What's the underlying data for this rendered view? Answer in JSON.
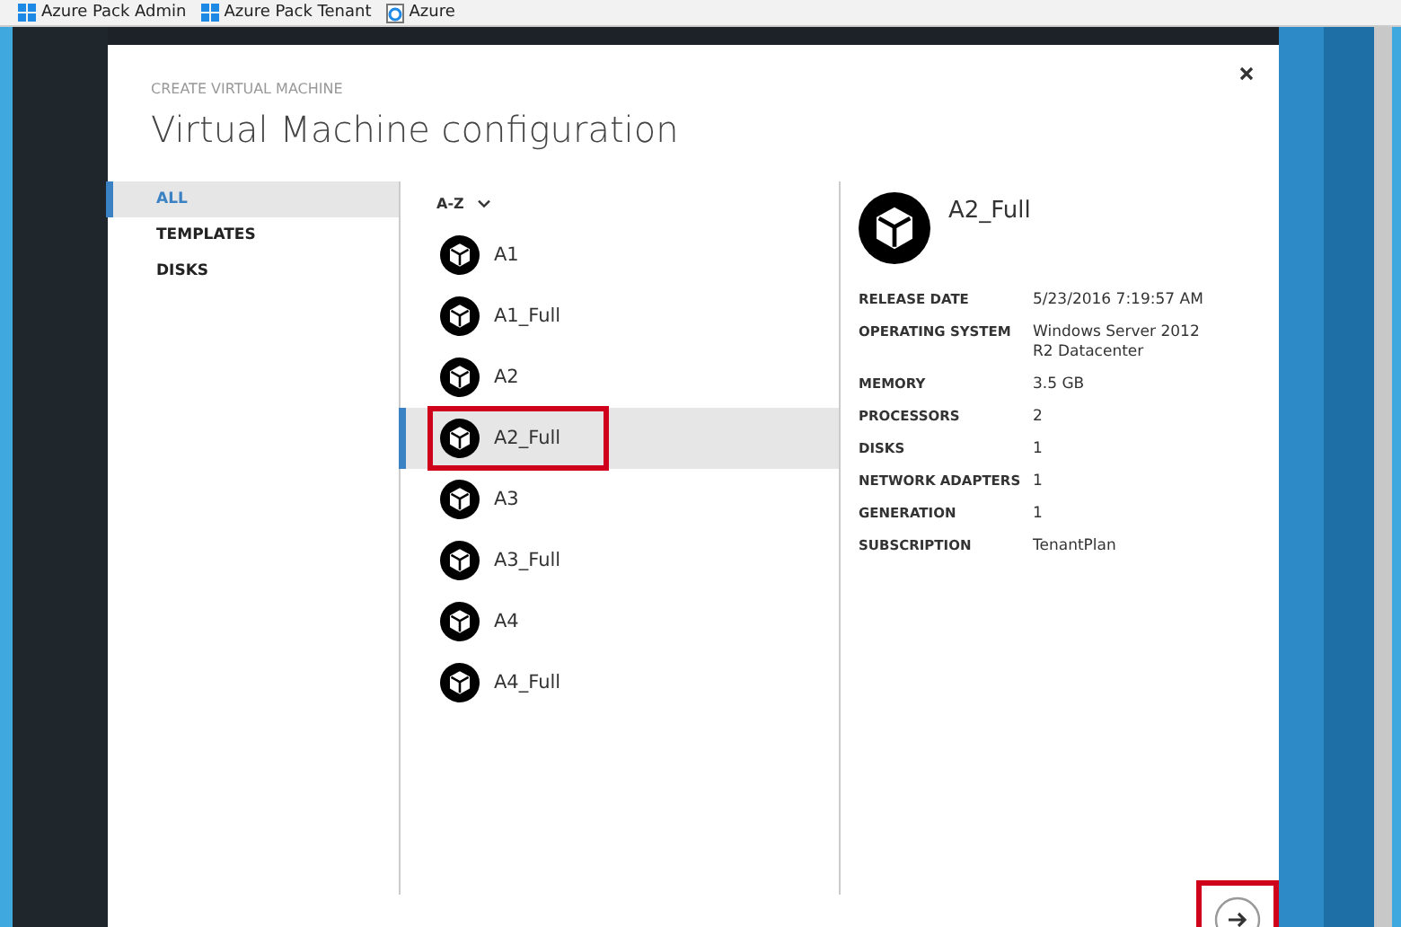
{
  "favorites_bar": [
    {
      "label": "Azure Pack Admin",
      "kind": "windows"
    },
    {
      "label": "Azure Pack Tenant",
      "kind": "windows"
    },
    {
      "label": "Azure",
      "kind": "ie"
    }
  ],
  "dialog": {
    "eyebrow": "CREATE VIRTUAL MACHINE",
    "title": "Virtual Machine configuration"
  },
  "filters": [
    {
      "label": "ALL",
      "selected": true
    },
    {
      "label": "TEMPLATES",
      "selected": false
    },
    {
      "label": "DISKS",
      "selected": false
    }
  ],
  "sort": {
    "label": "A-Z"
  },
  "images": [
    {
      "name": "A1",
      "selected": false,
      "highlighted": false
    },
    {
      "name": "A1_Full",
      "selected": false,
      "highlighted": false
    },
    {
      "name": "A2",
      "selected": false,
      "highlighted": false
    },
    {
      "name": "A2_Full",
      "selected": true,
      "highlighted": true
    },
    {
      "name": "A3",
      "selected": false,
      "highlighted": false
    },
    {
      "name": "A3_Full",
      "selected": false,
      "highlighted": false
    },
    {
      "name": "A4",
      "selected": false,
      "highlighted": false
    },
    {
      "name": "A4_Full",
      "selected": false,
      "highlighted": false
    }
  ],
  "details": {
    "name": "A2_Full",
    "properties": [
      {
        "label": "RELEASE DATE",
        "value": "5/23/2016 7:19:57 AM"
      },
      {
        "label": "OPERATING SYSTEM",
        "value": "Windows Server 2012 R2 Datacenter"
      },
      {
        "label": "MEMORY",
        "value": "3.5 GB"
      },
      {
        "label": "PROCESSORS",
        "value": "2"
      },
      {
        "label": "DISKS",
        "value": "1"
      },
      {
        "label": "NETWORK ADAPTERS",
        "value": "1"
      },
      {
        "label": "GENERATION",
        "value": "1"
      },
      {
        "label": "SUBSCRIPTION",
        "value": "TenantPlan"
      }
    ]
  },
  "next_button": {
    "highlighted": true
  }
}
